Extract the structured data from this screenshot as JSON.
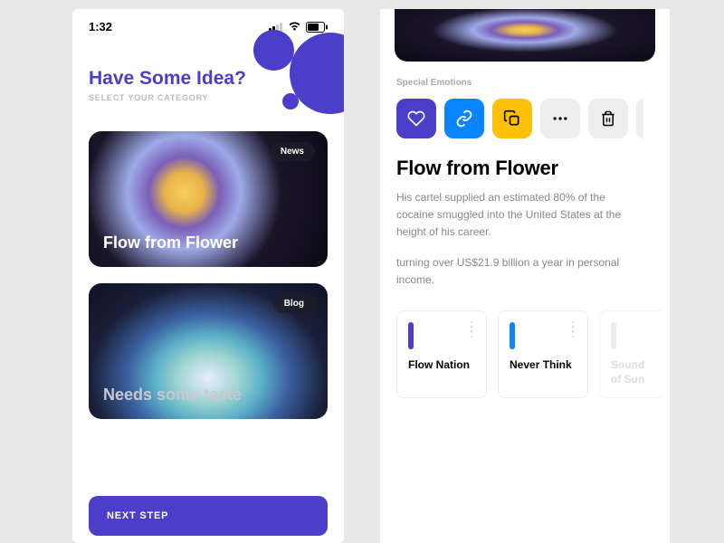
{
  "left": {
    "statusbar": {
      "time": "1:32"
    },
    "heading": "Have Some Idea?",
    "subheading": "SELECT YOUR CATEGORY",
    "cards": [
      {
        "badge": "News",
        "title": "Flow from Flower"
      },
      {
        "badge": "Blog",
        "title": "Needs some taste"
      }
    ],
    "next_button": "NEXT STEP"
  },
  "right": {
    "section_label": "Special Emotions",
    "actions": [
      "heart",
      "link",
      "copy",
      "more",
      "trash"
    ],
    "title": "Flow from Flower",
    "paragraphs": [
      "His cartel supplied an estimated 80% of the cocaine smuggled into the United States at the height of his career.",
      "turning over US$21.9 billion a year in personal income."
    ],
    "mini_cards": [
      {
        "title": "Flow Nation",
        "color": "purple"
      },
      {
        "title": "Never Think",
        "color": "blue"
      },
      {
        "title": "Sound of Sun",
        "color": "gray"
      }
    ]
  },
  "colors": {
    "primary": "#4b3fc9",
    "blue": "#0a84ff",
    "yellow": "#ffc107"
  }
}
